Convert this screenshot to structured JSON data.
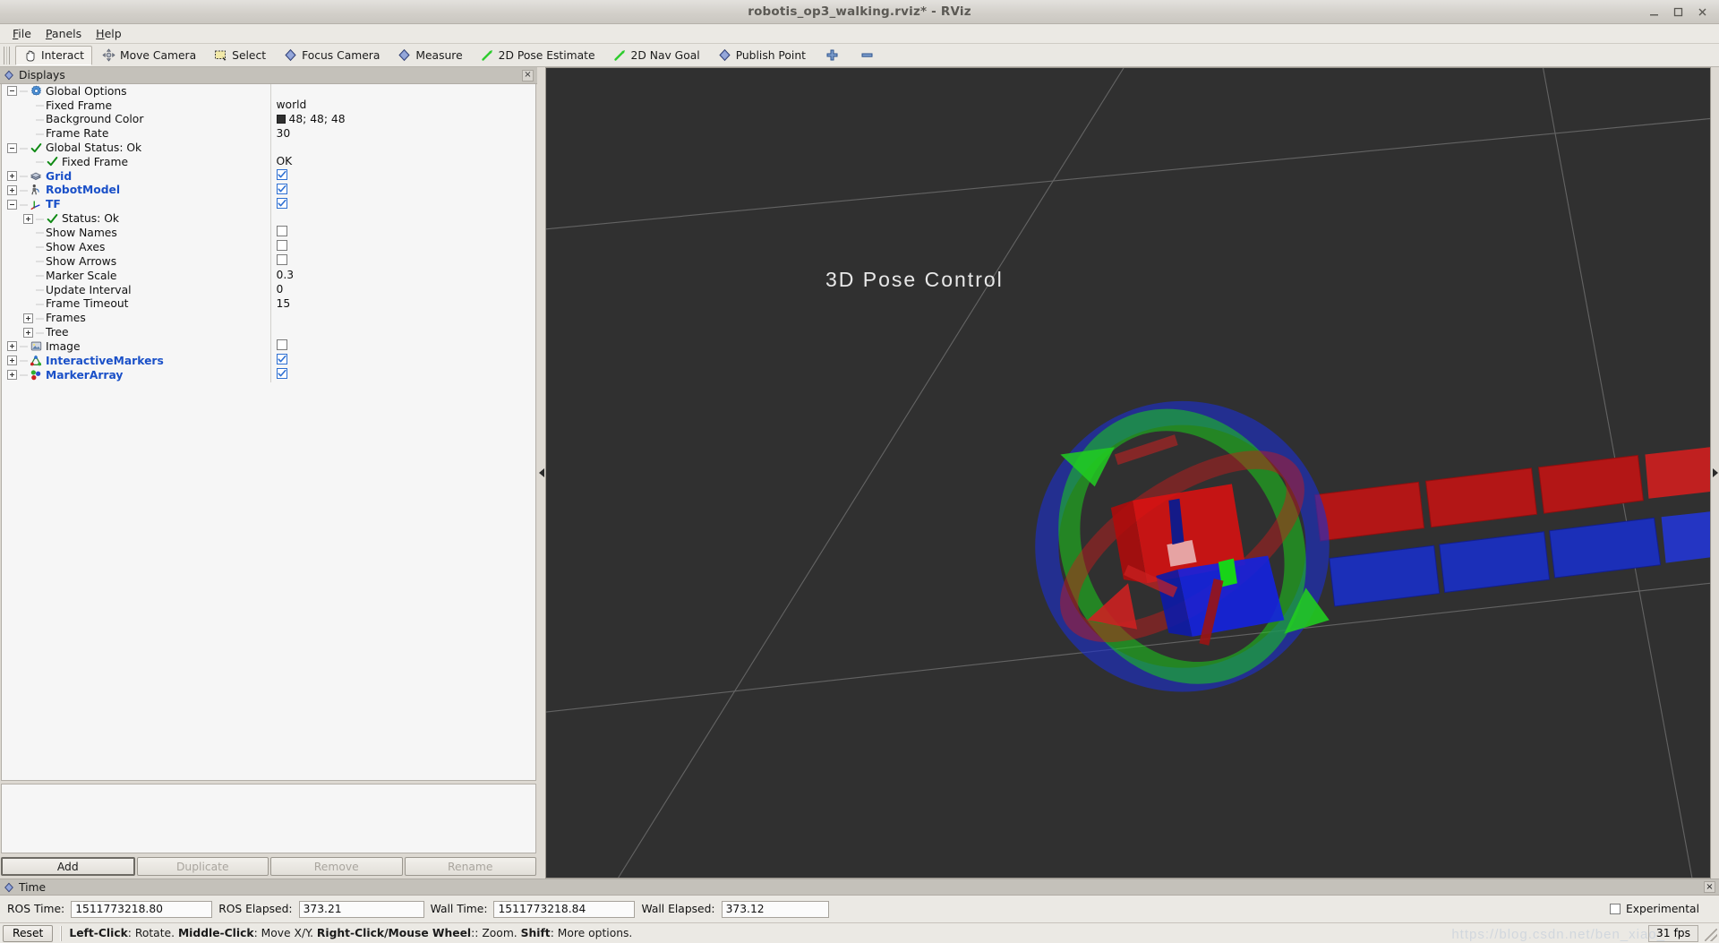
{
  "window": {
    "title": "robotis_op3_walking.rviz* - RViz",
    "buttons": [
      "minimize",
      "maximize",
      "close"
    ]
  },
  "menu": {
    "items": [
      "File",
      "Panels",
      "Help"
    ]
  },
  "toolbar": {
    "items": [
      {
        "label": "Interact",
        "icon": "hand-icon",
        "active": true
      },
      {
        "label": "Move Camera",
        "icon": "move-camera-icon",
        "active": false
      },
      {
        "label": "Select",
        "icon": "select-icon",
        "active": false
      },
      {
        "label": "Focus Camera",
        "icon": "focus-camera-icon",
        "active": false
      },
      {
        "label": "Measure",
        "icon": "measure-icon",
        "active": false
      },
      {
        "label": "2D Pose Estimate",
        "icon": "pose-estimate-icon",
        "active": false
      },
      {
        "label": "2D Nav Goal",
        "icon": "nav-goal-icon",
        "active": false
      },
      {
        "label": "Publish Point",
        "icon": "publish-point-icon",
        "active": false
      },
      {
        "label": "",
        "icon": "plus-icon",
        "active": false
      },
      {
        "label": "",
        "icon": "minus-icon",
        "active": false
      }
    ]
  },
  "displays": {
    "panel_title": "Displays",
    "close_label": "×",
    "rows": [
      {
        "indent": 0,
        "expander": "minus",
        "icon": "gear-icon",
        "label": "Global Options",
        "bold": false,
        "value_type": "none"
      },
      {
        "indent": 1,
        "expander": "none",
        "icon": "none",
        "label": "Fixed Frame",
        "bold": false,
        "value_type": "text",
        "value": "world"
      },
      {
        "indent": 1,
        "expander": "none",
        "icon": "none",
        "label": "Background Color",
        "bold": false,
        "value_type": "color",
        "value": "48; 48; 48",
        "color_hex": "#303030"
      },
      {
        "indent": 1,
        "expander": "none",
        "icon": "none",
        "label": "Frame Rate",
        "bold": false,
        "value_type": "text",
        "value": "30"
      },
      {
        "indent": 0,
        "expander": "minus",
        "icon": "check-icon",
        "label": "Global Status: Ok",
        "bold": false,
        "value_type": "none"
      },
      {
        "indent": 1,
        "expander": "none",
        "icon": "check-icon",
        "label": "Fixed Frame",
        "bold": false,
        "value_type": "text",
        "value": "OK"
      },
      {
        "indent": 0,
        "expander": "plus",
        "icon": "grid-icon",
        "label": "Grid",
        "bold": true,
        "value_type": "checkbox",
        "checked": true
      },
      {
        "indent": 0,
        "expander": "plus",
        "icon": "robot-icon",
        "label": "RobotModel",
        "bold": true,
        "value_type": "checkbox",
        "checked": true
      },
      {
        "indent": 0,
        "expander": "minus",
        "icon": "tf-icon",
        "label": "TF",
        "bold": true,
        "value_type": "checkbox",
        "checked": true
      },
      {
        "indent": 1,
        "expander": "plus",
        "icon": "check-icon",
        "label": "Status: Ok",
        "bold": false,
        "value_type": "none"
      },
      {
        "indent": 1,
        "expander": "none",
        "icon": "none",
        "label": "Show Names",
        "bold": false,
        "value_type": "checkbox",
        "checked": false
      },
      {
        "indent": 1,
        "expander": "none",
        "icon": "none",
        "label": "Show Axes",
        "bold": false,
        "value_type": "checkbox",
        "checked": false
      },
      {
        "indent": 1,
        "expander": "none",
        "icon": "none",
        "label": "Show Arrows",
        "bold": false,
        "value_type": "checkbox",
        "checked": false
      },
      {
        "indent": 1,
        "expander": "none",
        "icon": "none",
        "label": "Marker Scale",
        "bold": false,
        "value_type": "text",
        "value": "0.3"
      },
      {
        "indent": 1,
        "expander": "none",
        "icon": "none",
        "label": "Update Interval",
        "bold": false,
        "value_type": "text",
        "value": "0"
      },
      {
        "indent": 1,
        "expander": "none",
        "icon": "none",
        "label": "Frame Timeout",
        "bold": false,
        "value_type": "text",
        "value": "15"
      },
      {
        "indent": 1,
        "expander": "plus",
        "icon": "none",
        "label": "Frames",
        "bold": false,
        "value_type": "none"
      },
      {
        "indent": 1,
        "expander": "plus",
        "icon": "none",
        "label": "Tree",
        "bold": false,
        "value_type": "none"
      },
      {
        "indent": 0,
        "expander": "plus",
        "icon": "image-icon",
        "label": "Image",
        "bold": false,
        "value_type": "checkbox",
        "checked": false
      },
      {
        "indent": 0,
        "expander": "plus",
        "icon": "imarker-icon",
        "label": "InteractiveMarkers",
        "bold": true,
        "value_type": "checkbox",
        "checked": true
      },
      {
        "indent": 0,
        "expander": "plus",
        "icon": "marker-icon",
        "label": "MarkerArray",
        "bold": true,
        "value_type": "checkbox",
        "checked": true
      }
    ],
    "buttons": [
      {
        "label": "Add",
        "enabled": true
      },
      {
        "label": "Duplicate",
        "enabled": false
      },
      {
        "label": "Remove",
        "enabled": false
      },
      {
        "label": "Rename",
        "enabled": false
      }
    ]
  },
  "viewport": {
    "overlay_text": "3D  Pose  Control",
    "background_hex": "#303030",
    "grid_hex": "#8d8d8d"
  },
  "time": {
    "panel_title": "Time",
    "close_label": "×",
    "fields": [
      {
        "label": "ROS Time:",
        "value": "1511773218.80"
      },
      {
        "label": "ROS Elapsed:",
        "value": "373.21"
      },
      {
        "label": "Wall Time:",
        "value": "1511773218.84"
      },
      {
        "label": "Wall Elapsed:",
        "value": "373.12"
      }
    ],
    "experimental": {
      "label": "Experimental",
      "checked": false
    }
  },
  "statusbar": {
    "reset_label": "Reset",
    "hint_parts": [
      {
        "text": "Left-Click",
        "bold": true
      },
      {
        "text": ": Rotate. ",
        "bold": false
      },
      {
        "text": "Middle-Click",
        "bold": true
      },
      {
        "text": ": Move X/Y. ",
        "bold": false
      },
      {
        "text": "Right-Click/Mouse Wheel",
        "bold": true
      },
      {
        "text": ":: Zoom. ",
        "bold": false
      },
      {
        "text": "Shift",
        "bold": true
      },
      {
        "text": ": More options.",
        "bold": false
      }
    ],
    "fps": "31 fps",
    "watermark": "https://blog.csdn.net/ben_xiao_"
  }
}
